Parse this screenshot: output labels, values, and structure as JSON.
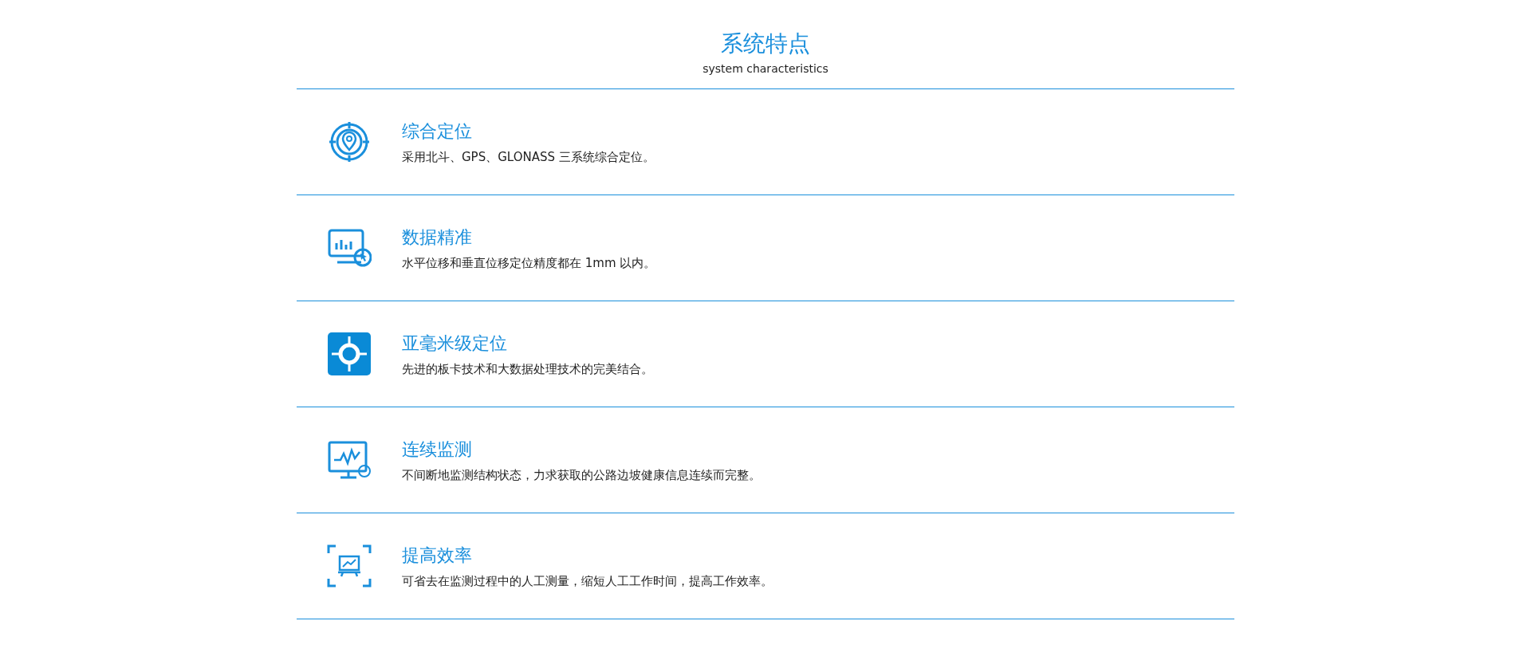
{
  "header": {
    "title": "系统特点",
    "subtitle": "system characteristics"
  },
  "features": [
    {
      "kind": "target-pin",
      "title": "综合定位",
      "description": "采用北斗、GPS、GLONASS 三系统综合定位。"
    },
    {
      "kind": "monitor-chart",
      "title": "数据精准",
      "description": "水平位移和垂直位移定位精度都在 1mm 以内。"
    },
    {
      "kind": "crosshair-square",
      "title": "亚毫米级定位",
      "description": "先进的板卡技术和大数据处理技术的完美结合。"
    },
    {
      "kind": "monitor-wave",
      "title": "连续监测",
      "description": "不间断地监测结构状态，力求获取的公路边坡健康信息连续而完整。"
    },
    {
      "kind": "frame-board",
      "title": "提高效率",
      "description": "可省去在监测过程中的人工测量，缩短人工工作时间，提高工作效率。"
    }
  ]
}
